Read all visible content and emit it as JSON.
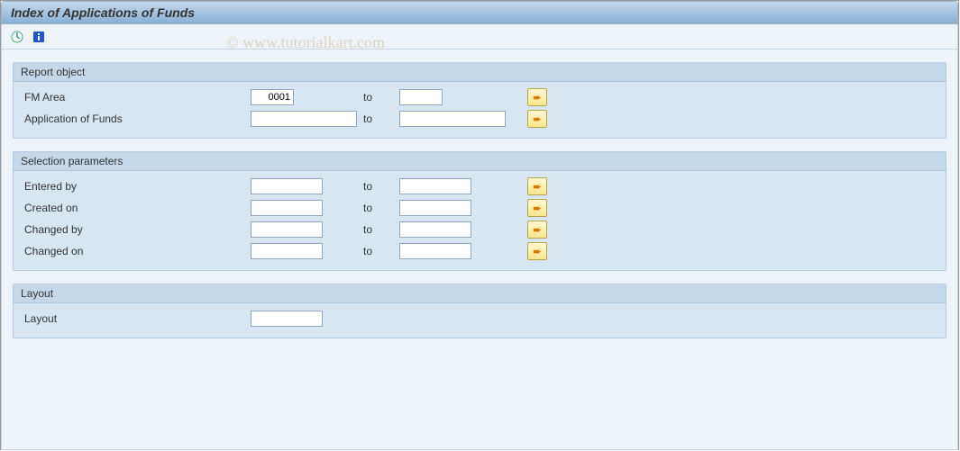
{
  "title": "Index of Applications of Funds",
  "watermark": "© www.tutorialkart.com",
  "groups": {
    "report_object": {
      "title": "Report object",
      "rows": {
        "fm_area": {
          "label": "FM Area",
          "from": "0001",
          "to_label": "to",
          "to": ""
        },
        "app_funds": {
          "label": "Application of Funds",
          "from": "",
          "to_label": "to",
          "to": ""
        }
      }
    },
    "selection_params": {
      "title": "Selection parameters",
      "rows": {
        "entered_by": {
          "label": "Entered by",
          "from": "",
          "to_label": "to",
          "to": ""
        },
        "created_on": {
          "label": "Created on",
          "from": "",
          "to_label": "to",
          "to": ""
        },
        "changed_by": {
          "label": "Changed by",
          "from": "",
          "to_label": "to",
          "to": ""
        },
        "changed_on": {
          "label": "Changed on",
          "from": "",
          "to_label": "to",
          "to": ""
        }
      }
    },
    "layout": {
      "title": "Layout",
      "rows": {
        "layout": {
          "label": "Layout",
          "value": ""
        }
      }
    }
  }
}
